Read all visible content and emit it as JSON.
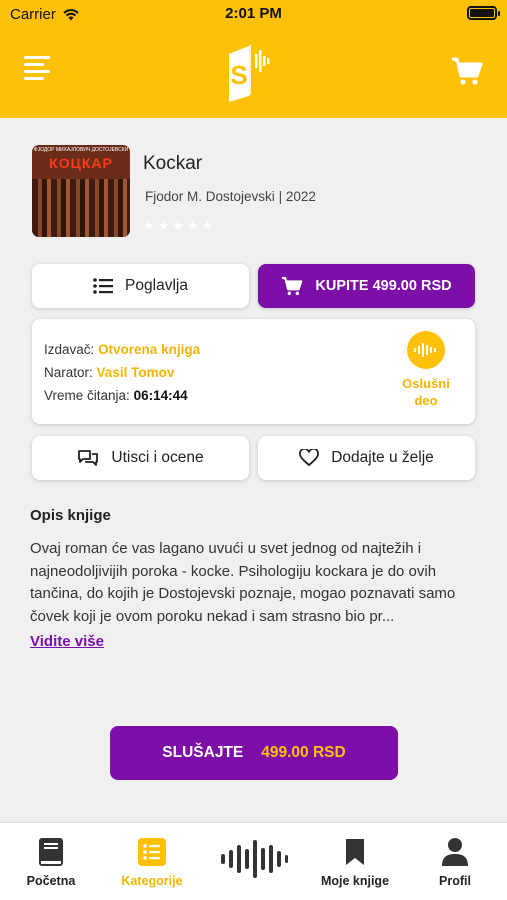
{
  "status_bar": {
    "carrier": "Carrier",
    "time": "2:01 PM"
  },
  "book": {
    "cover_title": "КОЦКАР",
    "cover_author": "ФЈОДОР МИХАЈЛОВИЧ ДОСТОЈЕВСКИ",
    "title": "Kockar",
    "author": "Fjodor M. Dostojevski",
    "year": "2022",
    "rating": 0,
    "rating_max": 5
  },
  "actions": {
    "chapters_label": "Poglavlja",
    "buy_label": "KUPITE 499.00 RSD",
    "reviews_label": "Utisci i ocene",
    "wishlist_label": "Dodajte u želje"
  },
  "details": {
    "publisher_label": "Izdavač:",
    "publisher": "Otvorena knjiga",
    "narrator_label": "Narator:",
    "narrator": "Vasil Tomov",
    "reading_time_label": "Vreme čitanja:",
    "reading_time": "06:14:44",
    "sample_label_line1": "Oslušni",
    "sample_label_line2": "deo"
  },
  "description": {
    "heading": "Opis knjige",
    "text": "Ovaj roman će vas lagano uvući u svet jednog od najtežih i najneodoljivijih poroka - kocke. Psihologiju kockara je do ovih tančina, do kojih je Dostojevski poznaje, mogao poznavati samo čovek koji je ovom poroku nekad i sam strasno bio pr...",
    "see_more": "Vidite više"
  },
  "listen_button": {
    "label": "SLUŠAJTE",
    "price": "499.00 RSD"
  },
  "tabs": [
    {
      "label": "Početna",
      "icon": "book-icon",
      "active": false
    },
    {
      "label": "Kategorije",
      "icon": "list-icon",
      "active": true
    },
    {
      "label": "",
      "icon": "soundwave-icon",
      "active": false
    },
    {
      "label": "Moje knjige",
      "icon": "bookmark-icon",
      "active": false
    },
    {
      "label": "Profil",
      "icon": "person-icon",
      "active": false
    }
  ],
  "colors": {
    "accent_yellow": "#ffc107",
    "accent_purple": "#7b0fa8",
    "background": "#f0f0f0"
  }
}
